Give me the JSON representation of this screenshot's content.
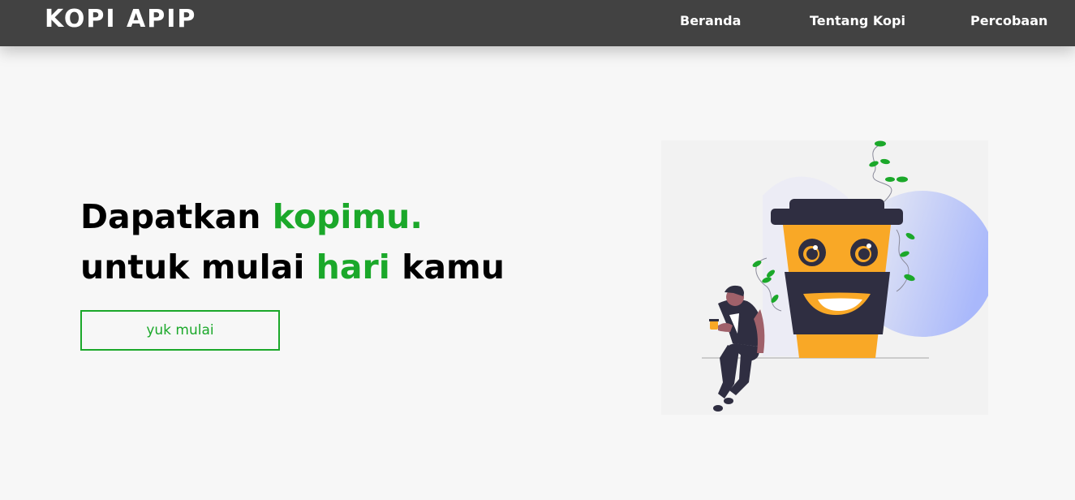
{
  "navbar": {
    "brand": "KOPI APIP",
    "links": [
      {
        "label": "Beranda"
      },
      {
        "label": "Tentang Kopi"
      },
      {
        "label": "Percobaan"
      }
    ]
  },
  "hero": {
    "line1_part1": "Dapatkan ",
    "line1_accent": "kopimu.",
    "line2_part1": "untuk mulai ",
    "line2_accent": "hari",
    "line2_part2": " kamu",
    "cta_label": "yuk mulai"
  },
  "illustration": {
    "icon": "coffee-cup-character-illustration"
  },
  "colors": {
    "navbar_bg": "#424242",
    "accent_green": "#1ba82a",
    "page_bg": "#f7f7f7",
    "cup_orange": "#f9a826",
    "cup_dark": "#2f2e41",
    "blob_blue": "#a9b8fb"
  }
}
